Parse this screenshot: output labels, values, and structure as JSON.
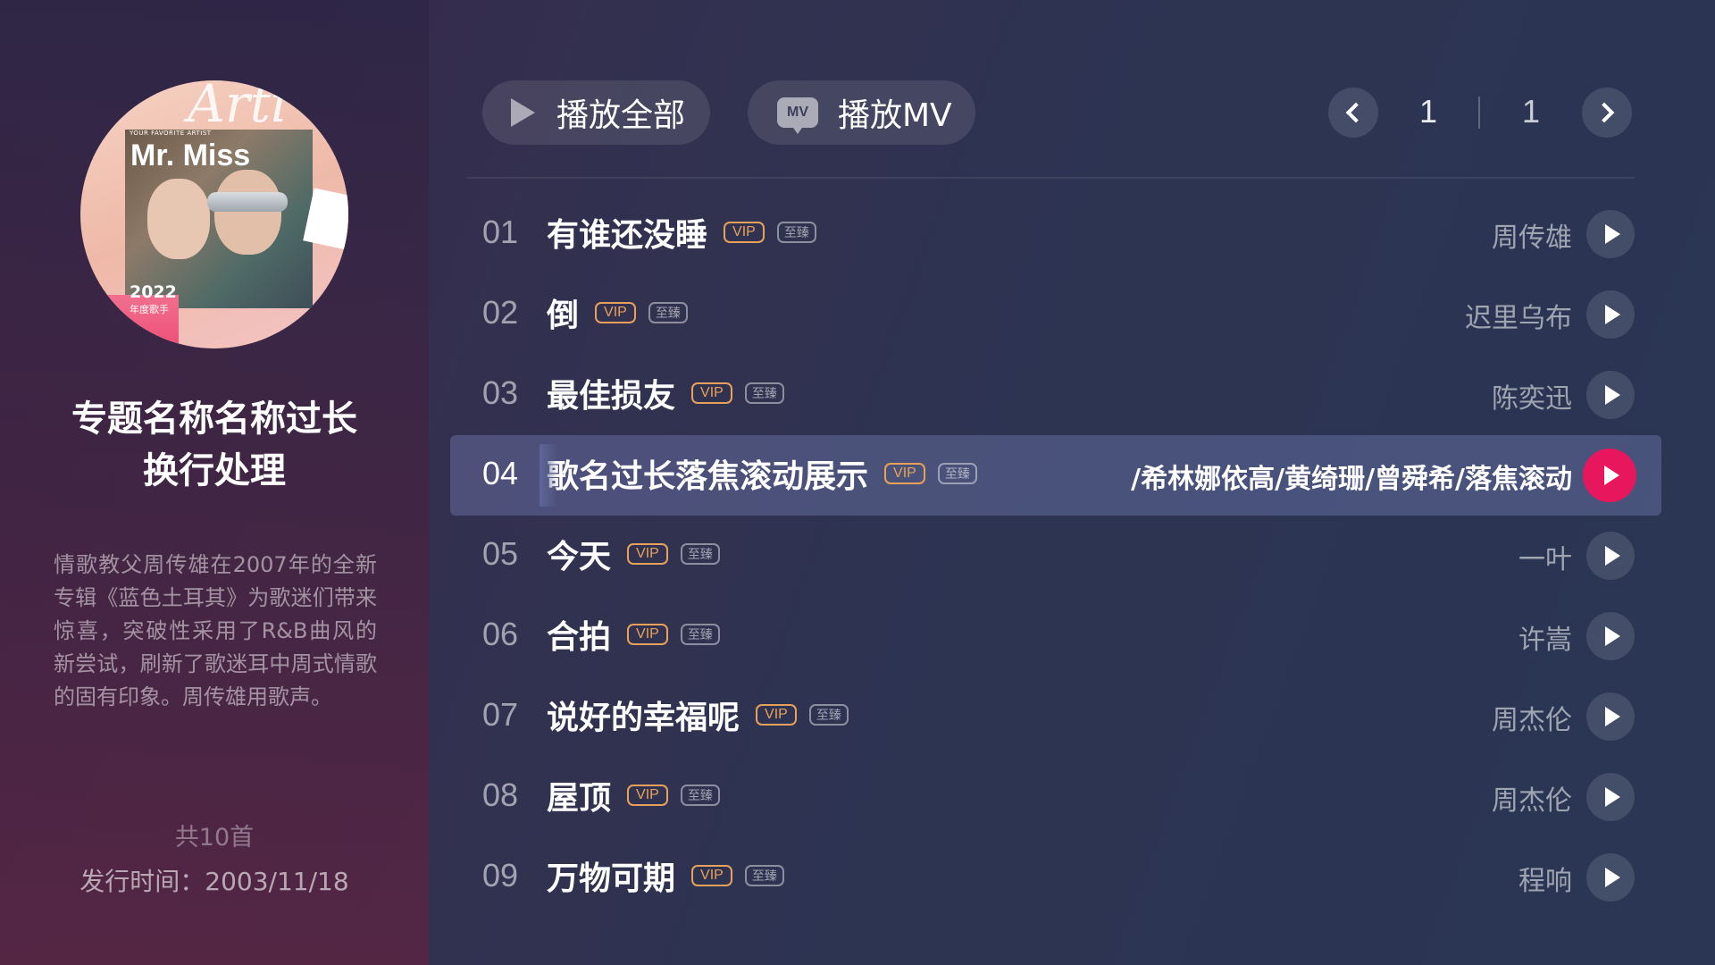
{
  "album": {
    "cover": {
      "script_text": "Arti",
      "small_text": "YOUR FAVORITE ARTIST",
      "artist_name": "Mr. Miss",
      "year": "2022",
      "sub": "年度歌手"
    },
    "title_line1": "专题名称名称过长",
    "title_line2": "换行处理",
    "description": "情歌教父周传雄在2007年的全新专辑《蓝色土耳其》为歌迷们带来惊喜，突破性采用了R&B曲风的新尝试，刷新了歌迷耳中周式情歌的固有印象。周传雄用歌声。",
    "track_count": "共10首",
    "release_date": "发行时间：2003/11/18"
  },
  "toolbar": {
    "play_all_label": "播放全部",
    "play_mv_label": "播放MV",
    "mv_icon_text": "MV"
  },
  "pager": {
    "current": "1",
    "total": "1"
  },
  "badges": {
    "vip": "VIP",
    "zhi": "至臻"
  },
  "tracks": [
    {
      "num": "01",
      "title": "有谁还没睡",
      "artist": "周传雄"
    },
    {
      "num": "02",
      "title": "倒",
      "artist": "迟里乌布"
    },
    {
      "num": "03",
      "title": "最佳损友",
      "artist": "陈奕迅"
    },
    {
      "num": "04",
      "title": "歌名过长落焦滚动展示",
      "artist": "/希林娜依高/黄绮珊/曾舜希/落焦滚动"
    },
    {
      "num": "05",
      "title": "今天",
      "artist": "一叶"
    },
    {
      "num": "06",
      "title": "合拍",
      "artist": "许嵩"
    },
    {
      "num": "07",
      "title": "说好的幸福呢",
      "artist": "周杰伦"
    },
    {
      "num": "08",
      "title": "屋顶",
      "artist": "周杰伦"
    },
    {
      "num": "09",
      "title": "万物可期",
      "artist": "程响"
    }
  ],
  "colors": {
    "accent_play": "#e8175d",
    "vip": "#e8a15a"
  }
}
